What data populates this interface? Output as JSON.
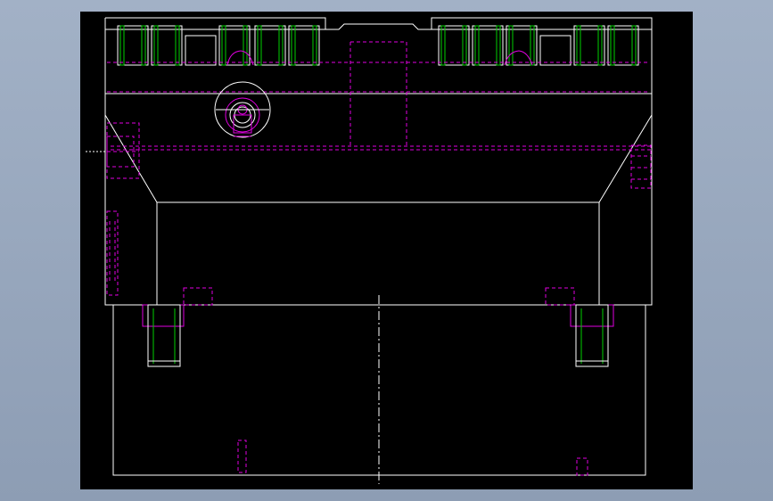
{
  "canvas": {
    "background": "#000000",
    "frame_color": "#9aa9bf"
  },
  "colors": {
    "outline": "#ffffff",
    "thread": "#00d000",
    "hidden": "#e000e0"
  }
}
